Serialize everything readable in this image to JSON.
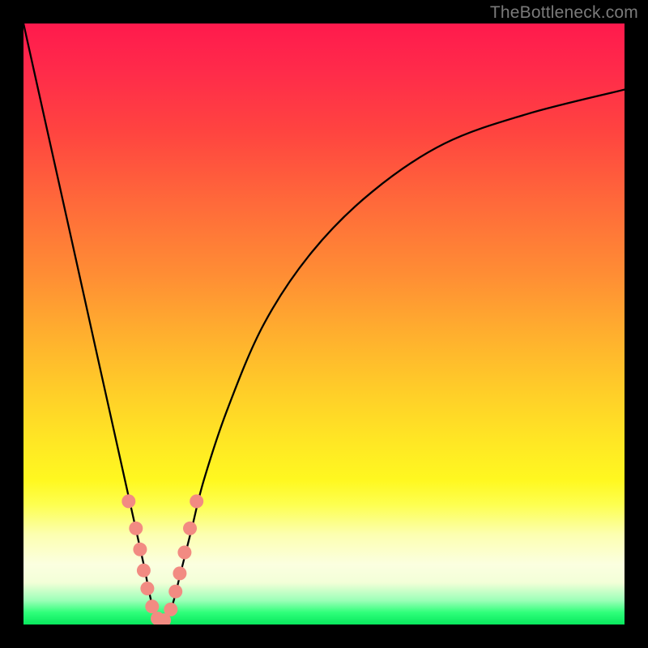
{
  "watermark": {
    "text": "TheBottleneck.com"
  },
  "chart_data": {
    "type": "line",
    "title": "",
    "xlabel": "",
    "ylabel": "",
    "xlim": [
      0,
      100
    ],
    "ylim": [
      0,
      100
    ],
    "series": [
      {
        "name": "bottleneck-curve",
        "x": [
          0,
          4,
          8,
          12,
          16,
          18,
          20,
          21,
          22,
          23,
          24,
          25,
          26,
          28,
          30,
          34,
          40,
          48,
          58,
          70,
          84,
          100
        ],
        "values": [
          100,
          82,
          64,
          46,
          28,
          19,
          10,
          5,
          1,
          0,
          1,
          4,
          8,
          16,
          24,
          36,
          50,
          62,
          72,
          80,
          85,
          89
        ]
      }
    ],
    "markers": {
      "name": "highlight-dots",
      "color": "#f28b82",
      "points": [
        {
          "x": 17.5,
          "y_pct": 79.5
        },
        {
          "x": 18.7,
          "y_pct": 84.0
        },
        {
          "x": 19.4,
          "y_pct": 87.5
        },
        {
          "x": 20.0,
          "y_pct": 91.0
        },
        {
          "x": 20.6,
          "y_pct": 94.0
        },
        {
          "x": 21.4,
          "y_pct": 97.0
        },
        {
          "x": 22.3,
          "y_pct": 99.0
        },
        {
          "x": 23.4,
          "y_pct": 99.3
        },
        {
          "x": 24.5,
          "y_pct": 97.5
        },
        {
          "x": 25.3,
          "y_pct": 94.5
        },
        {
          "x": 26.0,
          "y_pct": 91.5
        },
        {
          "x": 26.8,
          "y_pct": 88.0
        },
        {
          "x": 27.7,
          "y_pct": 84.0
        },
        {
          "x": 28.8,
          "y_pct": 79.5
        }
      ]
    },
    "gradient_stops": [
      {
        "pos": 0,
        "color": "#ff1a4d"
      },
      {
        "pos": 50,
        "color": "#ffb02e"
      },
      {
        "pos": 78,
        "color": "#fdff4f"
      },
      {
        "pos": 100,
        "color": "#08e85d"
      }
    ]
  }
}
